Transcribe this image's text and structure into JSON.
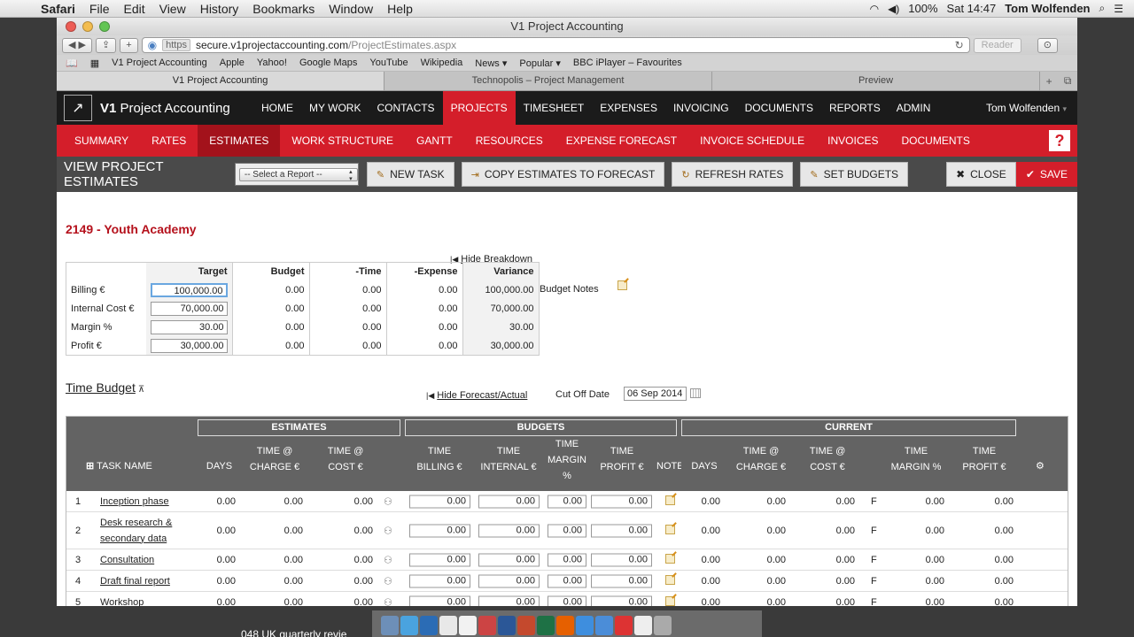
{
  "menubar": {
    "app": "Safari",
    "items": [
      "File",
      "Edit",
      "View",
      "History",
      "Bookmarks",
      "Window",
      "Help"
    ],
    "battery": "100%",
    "clock": "Sat 14:47",
    "user": "Tom Wolfenden"
  },
  "window": {
    "title": "V1 Project Accounting"
  },
  "toolbar": {
    "https": "https",
    "host": "secure.v1projectaccounting.com",
    "path": "/ProjectEstimates.aspx",
    "reader": "Reader"
  },
  "bookmarks": [
    "V1 Project Accounting",
    "Apple",
    "Yahoo!",
    "Google Maps",
    "YouTube",
    "Wikipedia",
    "News ▾",
    "Popular ▾",
    "BBC iPlayer – Favourites"
  ],
  "tabs": [
    "V1 Project Accounting",
    "Technopolis – Project Management",
    "Preview"
  ],
  "app": {
    "logo_bold": "V1",
    "logo_rest": "Project Accounting",
    "nav": [
      "HOME",
      "MY WORK",
      "CONTACTS",
      "PROJECTS",
      "TIMESHEET",
      "EXPENSES",
      "INVOICING",
      "DOCUMENTS",
      "REPORTS",
      "ADMIN"
    ],
    "user": "Tom Wolfenden",
    "subnav": [
      "SUMMARY",
      "RATES",
      "ESTIMATES",
      "WORK STRUCTURE",
      "GANTT",
      "RESOURCES",
      "EXPENSE FORECAST",
      "INVOICE SCHEDULE",
      "INVOICES",
      "DOCUMENTS"
    ],
    "help": "?"
  },
  "actionbar": {
    "title": "VIEW PROJECT ESTIMATES",
    "select_report": "-- Select a Report --",
    "new_task": "NEW TASK",
    "copy": "COPY ESTIMATES TO FORECAST",
    "refresh": "REFRESH RATES",
    "set_budgets": "SET BUDGETS",
    "close": "CLOSE",
    "save": "SAVE"
  },
  "project": {
    "title": "2149 - Youth Academy",
    "hide_breakdown": "Hide Breakdown",
    "budget_notes": "Budget Notes"
  },
  "budget": {
    "headers": [
      "Target",
      "Budget",
      "-Time",
      "-Expense",
      "Variance"
    ],
    "rows": [
      {
        "label": "Billing €",
        "target": "100,000.00",
        "budget": "0.00",
        "time": "0.00",
        "expense": "0.00",
        "variance": "100,000.00"
      },
      {
        "label": "Internal Cost €",
        "target": "70,000.00",
        "budget": "0.00",
        "time": "0.00",
        "expense": "0.00",
        "variance": "70,000.00"
      },
      {
        "label": "Margin %",
        "target": "30.00",
        "budget": "0.00",
        "time": "0.00",
        "expense": "0.00",
        "variance": "30.00"
      },
      {
        "label": "Profit €",
        "target": "30,000.00",
        "budget": "0.00",
        "time": "0.00",
        "expense": "0.00",
        "variance": "30,000.00"
      }
    ]
  },
  "timebudget": {
    "title": "Time Budget",
    "hide_forecast": "Hide Forecast/Actual",
    "cutoff_label": "Cut Off Date",
    "cutoff_value": "06 Sep 2014"
  },
  "grid": {
    "groups": [
      "ESTIMATES",
      "BUDGETS",
      "CURRENT"
    ],
    "headers": {
      "task": "TASK NAME",
      "days": "DAYS",
      "time_charge": "TIME @\nCHARGE €",
      "time_cost": "TIME @\nCOST €",
      "time_billing": "TIME\nBILLING €",
      "time_internal": "TIME\nINTERNAL €",
      "time_margin": "TIME\nMARGIN\n%",
      "time_profit": "TIME\nPROFIT €",
      "note": "NOTE",
      "cur_days": "DAYS",
      "cur_charge": "TIME @\nCHARGE €",
      "cur_cost": "TIME @\nCOST €",
      "cur_margin": "TIME\nMARGIN %",
      "cur_profit": "TIME\nPROFIT €"
    },
    "rows": [
      {
        "n": "1",
        "name": "Inception phase",
        "days": "0.00",
        "charge": "0.00",
        "cost": "0.00",
        "billing": "0.00",
        "internal": "0.00",
        "margin": "0.00",
        "profit": "0.00",
        "c_days": "0.00",
        "c_charge": "0.00",
        "c_cost": "0.00",
        "flag": "F",
        "c_margin": "0.00",
        "c_profit": "0.00"
      },
      {
        "n": "2",
        "name": "Desk research & secondary data",
        "days": "0.00",
        "charge": "0.00",
        "cost": "0.00",
        "billing": "0.00",
        "internal": "0.00",
        "margin": "0.00",
        "profit": "0.00",
        "c_days": "0.00",
        "c_charge": "0.00",
        "c_cost": "0.00",
        "flag": "F",
        "c_margin": "0.00",
        "c_profit": "0.00"
      },
      {
        "n": "3",
        "name": "Consultation",
        "days": "0.00",
        "charge": "0.00",
        "cost": "0.00",
        "billing": "0.00",
        "internal": "0.00",
        "margin": "0.00",
        "profit": "0.00",
        "c_days": "0.00",
        "c_charge": "0.00",
        "c_cost": "0.00",
        "flag": "F",
        "c_margin": "0.00",
        "c_profit": "0.00"
      },
      {
        "n": "4",
        "name": "Draft final report",
        "days": "0.00",
        "charge": "0.00",
        "cost": "0.00",
        "billing": "0.00",
        "internal": "0.00",
        "margin": "0.00",
        "profit": "0.00",
        "c_days": "0.00",
        "c_charge": "0.00",
        "c_cost": "0.00",
        "flag": "F",
        "c_margin": "0.00",
        "c_profit": "0.00"
      },
      {
        "n": "5",
        "name": "Workshop",
        "days": "0.00",
        "charge": "0.00",
        "cost": "0.00",
        "billing": "0.00",
        "internal": "0.00",
        "margin": "0.00",
        "profit": "0.00",
        "c_days": "0.00",
        "c_charge": "0.00",
        "c_cost": "0.00",
        "flag": "F",
        "c_margin": "0.00",
        "c_profit": "0.00"
      }
    ]
  },
  "desktop": {
    "file_label": "048 UK quarterly revie"
  },
  "colors": {
    "brand_red": "#d41e2a",
    "header_dark": "#1b1b1b",
    "grid_header": "#636363",
    "title_red": "#b5111c"
  }
}
